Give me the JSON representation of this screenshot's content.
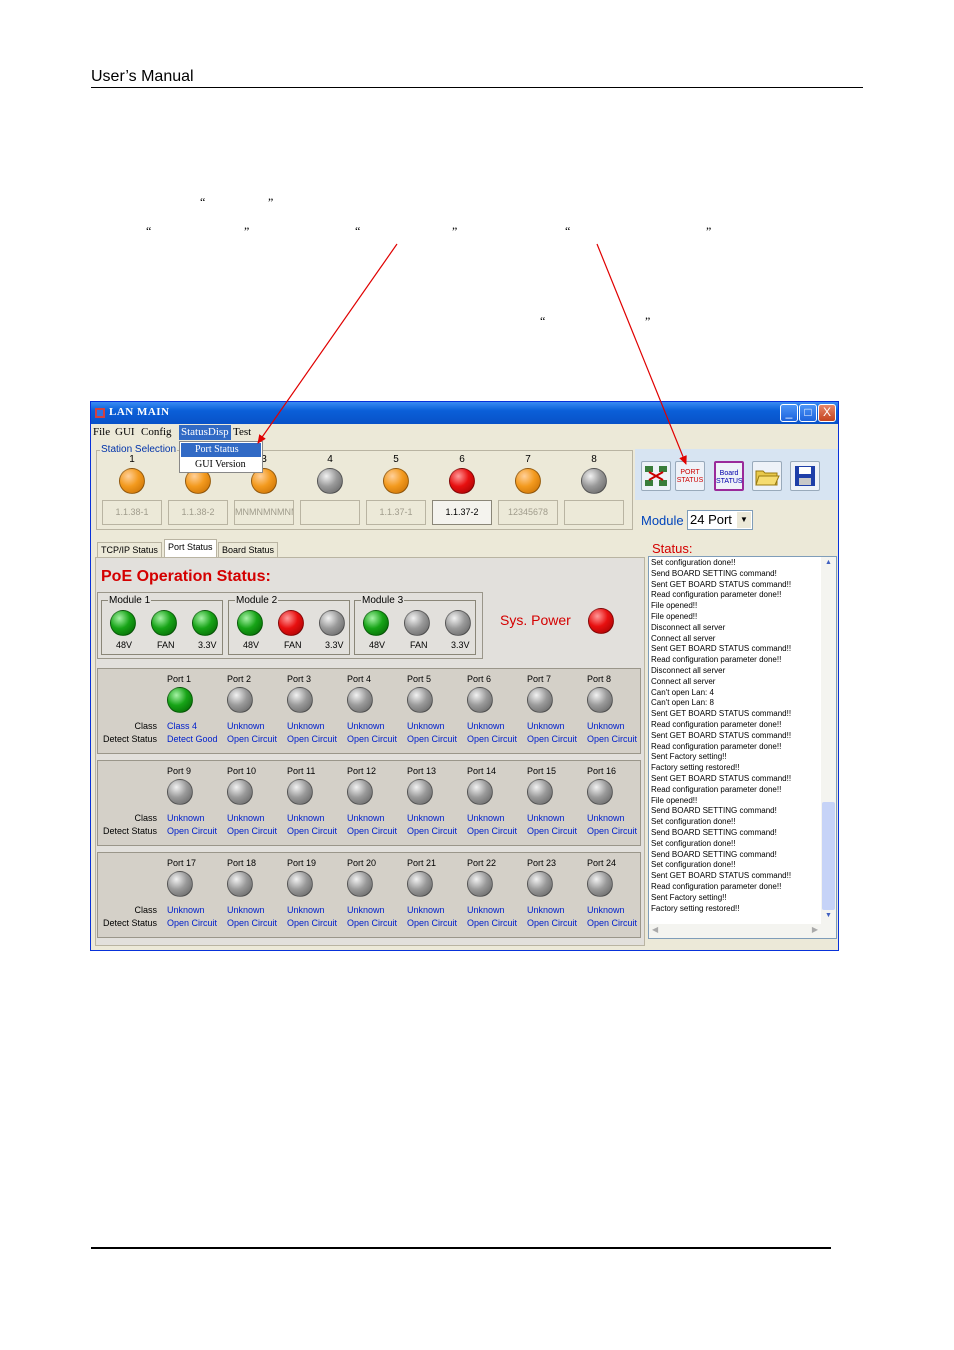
{
  "header": {
    "title": "User’s  Manual"
  },
  "quotes": [
    {
      "text": "“"
    },
    {
      "text": "”"
    },
    {
      "text": "“"
    },
    {
      "text": "”"
    },
    {
      "text": "“"
    },
    {
      "text": "”"
    },
    {
      "text": "“"
    },
    {
      "text": "”"
    },
    {
      "text": "“"
    },
    {
      "text": "”"
    }
  ],
  "window": {
    "title": "LAN MAIN",
    "controls": {
      "minimize": "_",
      "maximize": "□",
      "close": "X"
    }
  },
  "menu": [
    "File",
    "GUI",
    "Config",
    "StatusDisp",
    "Test"
  ],
  "dropdown": [
    "Port Status",
    "GUI Version"
  ],
  "station_selection": {
    "label": "Station Selection",
    "numbers": [
      "1",
      "2",
      "3",
      "4",
      "5",
      "6",
      "7",
      "8"
    ],
    "buttons": [
      "1.1.38-1",
      "1.1.38-2",
      "MNMNMNMNMN",
      "",
      "1.1.37-1",
      "1.1.37-2",
      "12345678",
      ""
    ],
    "led_colors": [
      "orange",
      "orange",
      "orange",
      "gray",
      "orange",
      "red",
      "orange",
      "gray"
    ]
  },
  "toolbar": {
    "port_status_btn": "PORT STATUS",
    "board_status_btn": "Board STATUS",
    "module_label": "Module",
    "module_value": "24 Port"
  },
  "tabs": [
    "TCP/IP Status",
    "Port Status",
    "Board Status"
  ],
  "poe": {
    "title": "PoE Operation Status:",
    "sys_power_label": "Sys. Power",
    "modules": [
      {
        "name": "Module 1",
        "labels": [
          "48V",
          "FAN",
          "3.3V"
        ],
        "colors": [
          "green",
          "green",
          "green"
        ]
      },
      {
        "name": "Module 2",
        "labels": [
          "48V",
          "FAN",
          "3.3V"
        ],
        "colors": [
          "green",
          "red",
          "gray"
        ]
      },
      {
        "name": "Module 3",
        "labels": [
          "48V",
          "FAN",
          "3.3V"
        ],
        "colors": [
          "green",
          "gray",
          "gray"
        ]
      }
    ]
  },
  "ports": {
    "class_label": "Class",
    "detect_label": "Detect Status",
    "rows": [
      {
        "names": [
          "Port 1",
          "Port 2",
          "Port 3",
          "Port 4",
          "Port 5",
          "Port 6",
          "Port 7",
          "Port 8"
        ],
        "classes": [
          "Class 4",
          "Unknown",
          "Unknown",
          "Unknown",
          "Unknown",
          "Unknown",
          "Unknown",
          "Unknown"
        ],
        "detects": [
          "Detect Good",
          "Open Circuit",
          "Open Circuit",
          "Open Circuit",
          "Open Circuit",
          "Open Circuit",
          "Open Circuit",
          "Open Circuit"
        ],
        "colors": [
          "green",
          "gray",
          "gray",
          "gray",
          "gray",
          "gray",
          "gray",
          "gray"
        ]
      },
      {
        "names": [
          "Port 9",
          "Port 10",
          "Port 11",
          "Port 12",
          "Port 13",
          "Port 14",
          "Port 15",
          "Port 16"
        ],
        "classes": [
          "Unknown",
          "Unknown",
          "Unknown",
          "Unknown",
          "Unknown",
          "Unknown",
          "Unknown",
          "Unknown"
        ],
        "detects": [
          "Open Circuit",
          "Open Circuit",
          "Open Circuit",
          "Open Circuit",
          "Open Circuit",
          "Open Circuit",
          "Open Circuit",
          "Open Circuit"
        ],
        "colors": [
          "gray",
          "gray",
          "gray",
          "gray",
          "gray",
          "gray",
          "gray",
          "gray"
        ]
      },
      {
        "names": [
          "Port 17",
          "Port 18",
          "Port 19",
          "Port 20",
          "Port 21",
          "Port 22",
          "Port 23",
          "Port 24"
        ],
        "classes": [
          "Unknown",
          "Unknown",
          "Unknown",
          "Unknown",
          "Unknown",
          "Unknown",
          "Unknown",
          "Unknown"
        ],
        "detects": [
          "Open Circuit",
          "Open Circuit",
          "Open Circuit",
          "Open Circuit",
          "Open Circuit",
          "Open Circuit",
          "Open Circuit",
          "Open Circuit"
        ],
        "colors": [
          "gray",
          "gray",
          "gray",
          "gray",
          "gray",
          "gray",
          "gray",
          "gray"
        ]
      }
    ]
  },
  "status": {
    "label": "Status:",
    "log": [
      "Set configuration done!!",
      "Send BOARD SETTING command!",
      "Sent GET BOARD STATUS command!!",
      "Read configuration parameter done!!",
      "File opened!!",
      "File opened!!",
      "Disconnect all server",
      "Connect all server",
      "Sent GET BOARD STATUS command!!",
      "Read configuration parameter done!!",
      "Disconnect all server",
      "Connect all server",
      "Can't open Lan: 4",
      "Can't open Lan: 8",
      "Sent GET BOARD STATUS command!!",
      "Read configuration parameter done!!",
      "Sent GET BOARD STATUS command!!",
      "Read configuration parameter done!!",
      "Sent Factory setting!!",
      "Factory setting restored!!",
      "Sent GET BOARD STATUS command!!",
      "Read configuration parameter done!!",
      "File opened!!",
      "Send BOARD SETTING command!",
      "Set configuration done!!",
      "Send BOARD SETTING command!",
      "Set configuration done!!",
      "Send BOARD SETTING command!",
      "Set configuration done!!",
      "Sent GET BOARD STATUS command!!",
      "Read configuration parameter done!!",
      "Sent Factory setting!!",
      "Factory setting restored!!"
    ]
  },
  "colors": {
    "accent": "#d40000",
    "value_blue": "#0020cc",
    "titlebar": "#0a5fd8"
  }
}
